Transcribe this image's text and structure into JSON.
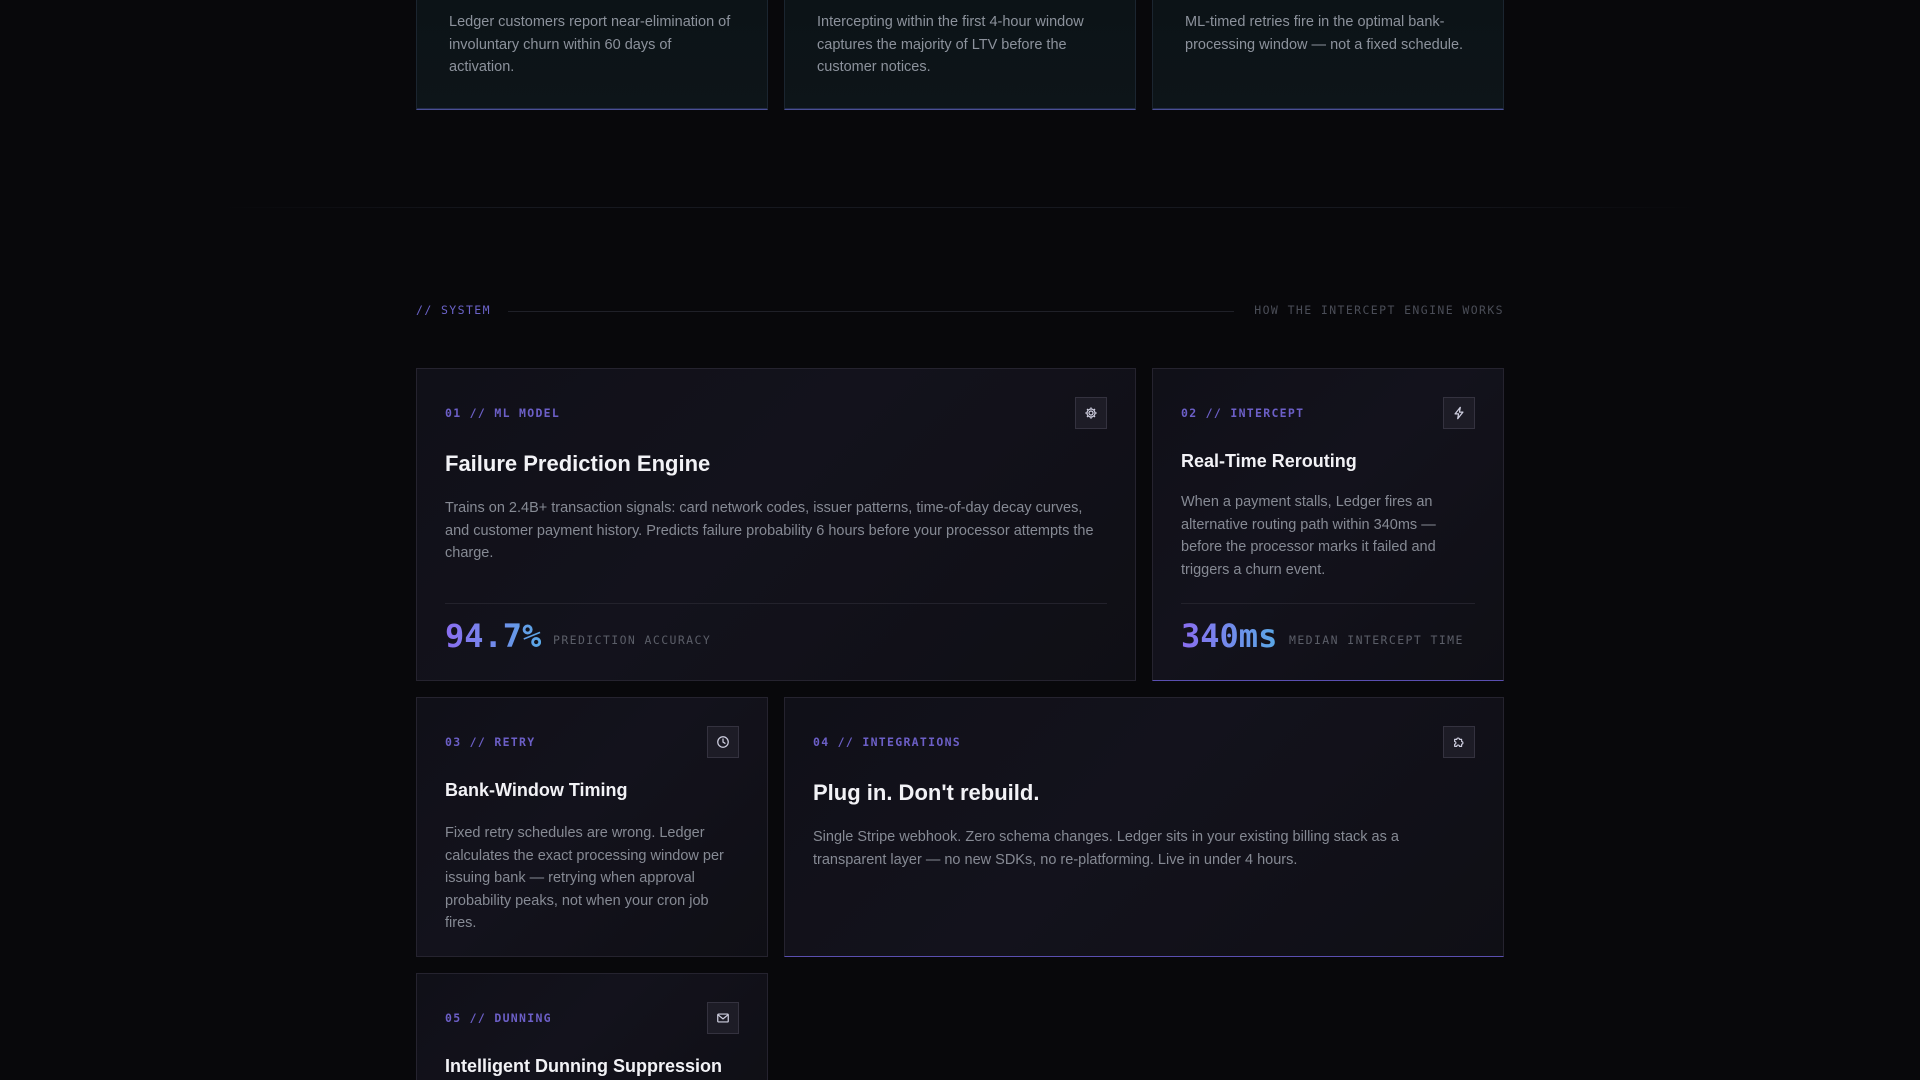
{
  "top_cards": [
    {
      "text": "Ledger customers report near-elimination of involuntary churn within 60 days of activation."
    },
    {
      "text": "Intercepting within the first 4-hour window captures the majority of LTV before the customer notices."
    },
    {
      "text": "ML-timed retries fire in the optimal bank-processing window — not a fixed schedule."
    }
  ],
  "section": {
    "tag": "// SYSTEM",
    "subtitle": "HOW THE INTERCEPT ENGINE WORKS"
  },
  "features": [
    {
      "label": "01 // ML MODEL",
      "icon": "cog-icon",
      "title": "Failure Prediction Engine",
      "description": "Trains on 2.4B+ transaction signals: card network codes, issuer patterns, time-of-day decay curves, and customer payment history. Predicts failure probability 6 hours before your processor attempts the charge.",
      "metric": "94.7%",
      "metric_label": "PREDICTION ACCURACY"
    },
    {
      "label": "02 // INTERCEPT",
      "icon": "lightning-icon",
      "title": "Real-Time Rerouting",
      "description": "When a payment stalls, Ledger fires an alternative routing path within 340ms — before the processor marks it failed and triggers a churn event.",
      "metric": "340ms",
      "metric_label": "MEDIAN INTERCEPT TIME"
    },
    {
      "label": "03 // RETRY",
      "icon": "clock-icon",
      "title": "Bank-Window Timing",
      "description": "Fixed retry schedules are wrong. Ledger calculates the exact processing window per issuing bank — retrying when approval probability peaks, not when your cron job fires."
    },
    {
      "label": "04 // INTEGRATIONS",
      "icon": "puzzle-icon",
      "title": "Plug in. Don't rebuild.",
      "description": "Single Stripe webhook. Zero schema changes. Ledger sits in your existing billing stack as a transparent layer — no new SDKs, no re-platforming. Live in under 4 hours."
    },
    {
      "label": "05 // DUNNING",
      "icon": "mail-icon",
      "title": "Intelligent Dunning Suppression"
    }
  ]
}
